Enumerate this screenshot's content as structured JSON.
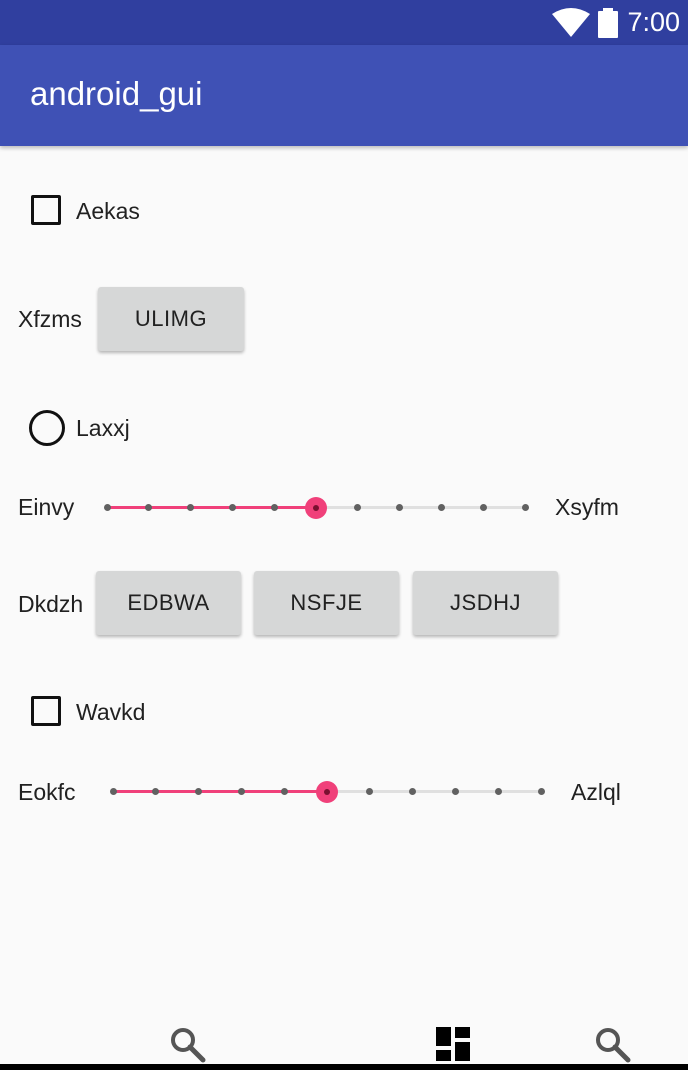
{
  "status_bar": {
    "time": "7:00",
    "icons": [
      "wifi-icon",
      "battery-icon"
    ]
  },
  "app_bar": {
    "title": "android_gui"
  },
  "content": {
    "checkbox_1": {
      "label": "Aekas",
      "checked": false
    },
    "row_1": {
      "label": "Xfzms",
      "button": "ULIMG"
    },
    "radio_1": {
      "label": "Laxxj",
      "selected": false
    },
    "seekbar_1": {
      "label_left": "Einvy",
      "label_right": "Xsyfm",
      "value_fraction": 0.5,
      "steps": 10
    },
    "row_2": {
      "label": "Dkdzh",
      "buttons": [
        "EDBWA",
        "NSFJE",
        "JSDHJ"
      ]
    },
    "checkbox_2": {
      "label": "Wavkd",
      "checked": false
    },
    "seekbar_2": {
      "label_left": "Eokfc",
      "label_right": "Azlql",
      "value_fraction": 0.5,
      "steps": 10
    }
  },
  "bottom_nav": {
    "items": [
      "search-icon",
      "dashboard-icon",
      "search-icon"
    ]
  },
  "colors": {
    "status_bar": "#303F9F",
    "app_bar": "#3F51B5",
    "accent": "#F0407A",
    "button_bg": "#D6D7D7",
    "background": "#FAFAFA"
  }
}
